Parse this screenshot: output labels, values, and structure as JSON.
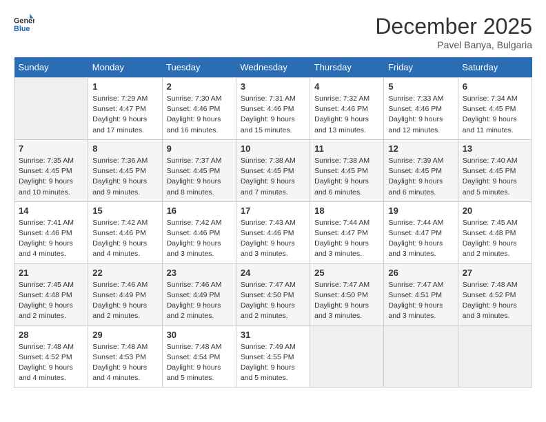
{
  "logo": {
    "line1": "General",
    "line2": "Blue"
  },
  "title": "December 2025",
  "location": "Pavel Banya, Bulgaria",
  "days_of_week": [
    "Sunday",
    "Monday",
    "Tuesday",
    "Wednesday",
    "Thursday",
    "Friday",
    "Saturday"
  ],
  "weeks": [
    [
      {
        "num": "",
        "empty": true
      },
      {
        "num": "1",
        "sunrise": "7:29 AM",
        "sunset": "4:47 PM",
        "daylight": "9 hours and 17 minutes."
      },
      {
        "num": "2",
        "sunrise": "7:30 AM",
        "sunset": "4:46 PM",
        "daylight": "9 hours and 16 minutes."
      },
      {
        "num": "3",
        "sunrise": "7:31 AM",
        "sunset": "4:46 PM",
        "daylight": "9 hours and 15 minutes."
      },
      {
        "num": "4",
        "sunrise": "7:32 AM",
        "sunset": "4:46 PM",
        "daylight": "9 hours and 13 minutes."
      },
      {
        "num": "5",
        "sunrise": "7:33 AM",
        "sunset": "4:46 PM",
        "daylight": "9 hours and 12 minutes."
      },
      {
        "num": "6",
        "sunrise": "7:34 AM",
        "sunset": "4:45 PM",
        "daylight": "9 hours and 11 minutes."
      }
    ],
    [
      {
        "num": "7",
        "sunrise": "7:35 AM",
        "sunset": "4:45 PM",
        "daylight": "9 hours and 10 minutes."
      },
      {
        "num": "8",
        "sunrise": "7:36 AM",
        "sunset": "4:45 PM",
        "daylight": "9 hours and 9 minutes."
      },
      {
        "num": "9",
        "sunrise": "7:37 AM",
        "sunset": "4:45 PM",
        "daylight": "9 hours and 8 minutes."
      },
      {
        "num": "10",
        "sunrise": "7:38 AM",
        "sunset": "4:45 PM",
        "daylight": "9 hours and 7 minutes."
      },
      {
        "num": "11",
        "sunrise": "7:38 AM",
        "sunset": "4:45 PM",
        "daylight": "9 hours and 6 minutes."
      },
      {
        "num": "12",
        "sunrise": "7:39 AM",
        "sunset": "4:45 PM",
        "daylight": "9 hours and 6 minutes."
      },
      {
        "num": "13",
        "sunrise": "7:40 AM",
        "sunset": "4:45 PM",
        "daylight": "9 hours and 5 minutes."
      }
    ],
    [
      {
        "num": "14",
        "sunrise": "7:41 AM",
        "sunset": "4:46 PM",
        "daylight": "9 hours and 4 minutes."
      },
      {
        "num": "15",
        "sunrise": "7:42 AM",
        "sunset": "4:46 PM",
        "daylight": "9 hours and 4 minutes."
      },
      {
        "num": "16",
        "sunrise": "7:42 AM",
        "sunset": "4:46 PM",
        "daylight": "9 hours and 3 minutes."
      },
      {
        "num": "17",
        "sunrise": "7:43 AM",
        "sunset": "4:46 PM",
        "daylight": "9 hours and 3 minutes."
      },
      {
        "num": "18",
        "sunrise": "7:44 AM",
        "sunset": "4:47 PM",
        "daylight": "9 hours and 3 minutes."
      },
      {
        "num": "19",
        "sunrise": "7:44 AM",
        "sunset": "4:47 PM",
        "daylight": "9 hours and 3 minutes."
      },
      {
        "num": "20",
        "sunrise": "7:45 AM",
        "sunset": "4:48 PM",
        "daylight": "9 hours and 2 minutes."
      }
    ],
    [
      {
        "num": "21",
        "sunrise": "7:45 AM",
        "sunset": "4:48 PM",
        "daylight": "9 hours and 2 minutes."
      },
      {
        "num": "22",
        "sunrise": "7:46 AM",
        "sunset": "4:49 PM",
        "daylight": "9 hours and 2 minutes."
      },
      {
        "num": "23",
        "sunrise": "7:46 AM",
        "sunset": "4:49 PM",
        "daylight": "9 hours and 2 minutes."
      },
      {
        "num": "24",
        "sunrise": "7:47 AM",
        "sunset": "4:50 PM",
        "daylight": "9 hours and 2 minutes."
      },
      {
        "num": "25",
        "sunrise": "7:47 AM",
        "sunset": "4:50 PM",
        "daylight": "9 hours and 3 minutes."
      },
      {
        "num": "26",
        "sunrise": "7:47 AM",
        "sunset": "4:51 PM",
        "daylight": "9 hours and 3 minutes."
      },
      {
        "num": "27",
        "sunrise": "7:48 AM",
        "sunset": "4:52 PM",
        "daylight": "9 hours and 3 minutes."
      }
    ],
    [
      {
        "num": "28",
        "sunrise": "7:48 AM",
        "sunset": "4:52 PM",
        "daylight": "9 hours and 4 minutes."
      },
      {
        "num": "29",
        "sunrise": "7:48 AM",
        "sunset": "4:53 PM",
        "daylight": "9 hours and 4 minutes."
      },
      {
        "num": "30",
        "sunrise": "7:48 AM",
        "sunset": "4:54 PM",
        "daylight": "9 hours and 5 minutes."
      },
      {
        "num": "31",
        "sunrise": "7:49 AM",
        "sunset": "4:55 PM",
        "daylight": "9 hours and 5 minutes."
      },
      {
        "num": "",
        "empty": true
      },
      {
        "num": "",
        "empty": true
      },
      {
        "num": "",
        "empty": true
      }
    ]
  ],
  "labels": {
    "sunrise": "Sunrise:",
    "sunset": "Sunset:",
    "daylight": "Daylight:"
  }
}
